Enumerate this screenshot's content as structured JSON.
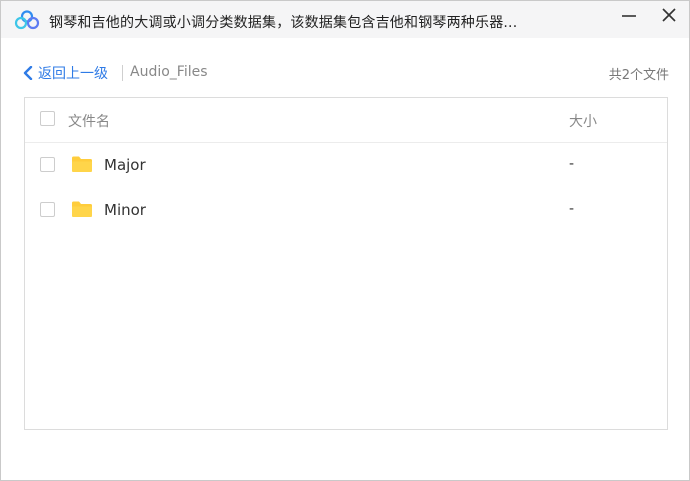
{
  "window": {
    "title": "钢琴和吉他的大调或小调分类数据集，该数据集包含吉他和钢琴两种乐器...",
    "app_icon": "baidu-netdisk-logo",
    "controls": [
      "minimize-icon",
      "close-icon"
    ]
  },
  "nav": {
    "back_label": "返回上一级",
    "current_folder": "Audio_Files",
    "file_count": "共2个文件"
  },
  "list": {
    "columns": {
      "name": "文件名",
      "size": "大小"
    },
    "rows": [
      {
        "name": "Major",
        "size": "-",
        "icon": "folder-icon",
        "checked": false
      },
      {
        "name": "Minor",
        "size": "-",
        "icon": "folder-icon",
        "checked": false
      }
    ]
  },
  "colors": {
    "accent": "#2f7be6",
    "folder": "#ffcd3c",
    "titlebar_bg": "#f5f5f6"
  }
}
